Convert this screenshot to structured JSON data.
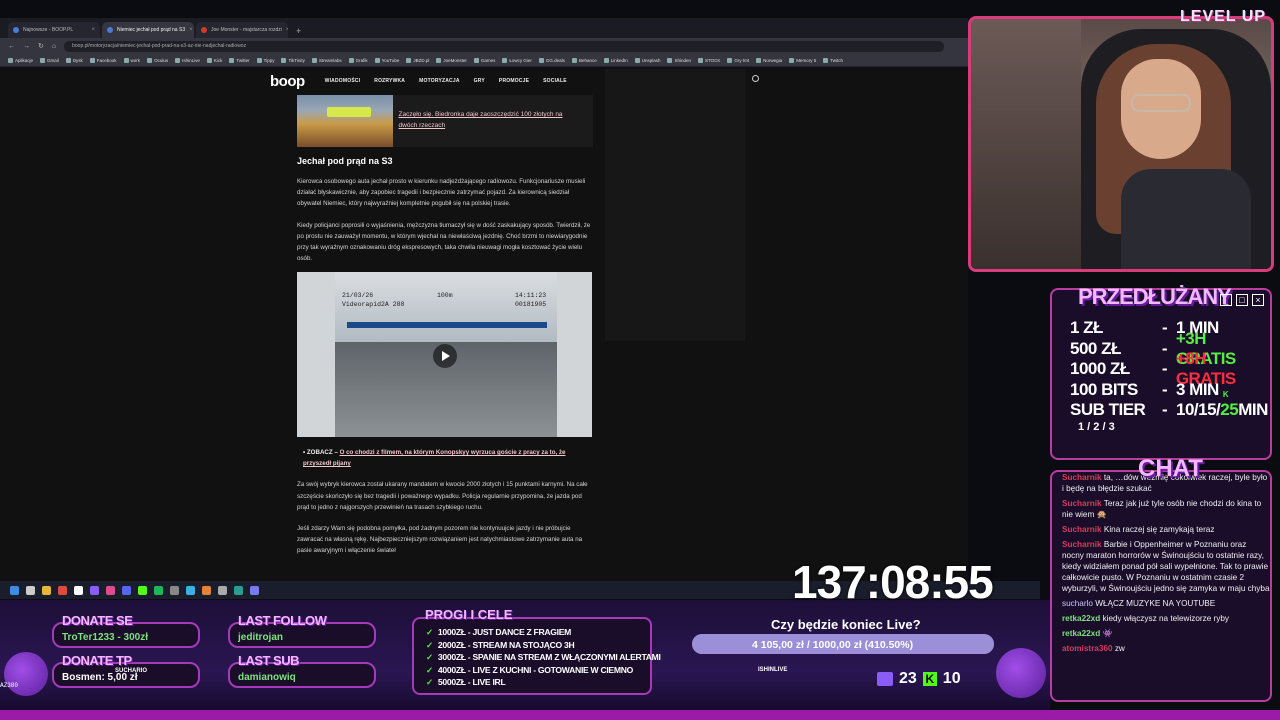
{
  "browser": {
    "tabs": [
      {
        "label": "Najnowsze - BOOP.PL",
        "color": "#4a7bd6"
      },
      {
        "label": "Niemiec jechał pod prąd na S3",
        "color": "#4a7bd6"
      },
      {
        "label": "Joe Monster - majstarcza rozdzi",
        "color": "#d23a2a"
      }
    ],
    "url": "boop.pl/motoryzacja/niemiec-jechal-pod-prad-na-s3-az-nie-nadjechal-radiowoz",
    "bookmarks": [
      "Aplikacje",
      "Gmail",
      "Dysk",
      "Facebook",
      "work",
      "Oculus",
      "IshinLive",
      "Kick",
      "Twitter",
      "Tippy",
      "TikTinity",
      "Streamlabs",
      "Grafik",
      "YouTube",
      "JBZD.pl",
      "JoeMonster",
      "Games",
      "Łowcy Gier",
      "GG.deals",
      "Behance",
      "LinkedIn",
      "Unsplash",
      "Shinden",
      "STOCK",
      "Gry tmt",
      "Norwegia",
      "Memory 5",
      "Twitch"
    ]
  },
  "site": {
    "logo": "boop",
    "nav": [
      "WIADOMOŚCI",
      "ROZRYWKA",
      "MOTORYZACJA",
      "GRY",
      "PROMOCJE",
      "SOCIALE"
    ]
  },
  "article": {
    "related_title": "Zaczęło się. Biedronka daje zaoszczędzić 100 złotych na dwóch rzeczach",
    "heading": "Jechał pod prąd na S3",
    "p1": "Kierowca osobowego auta jechał prosto w kierunku nadjeżdżającego radiowozu. Funkcjonariusze musieli działać błyskawicznie, aby zapobiec tragedii i bezpiecznie zatrzymać pojazd. Za kierownicą siedział obywatel Niemiec, który najwyraźniej kompletnie pogubił się na polskiej trasie.",
    "p2": "Kiedy policjanci poprosili o wyjaśnienia, mężczyzna tłumaczył się w dość zaskakujący sposób. Twierdził, że po prostu nie zauważył momentu, w którym wjechał na niewłaściwą jezdnię. Choć brzmi to niewiarygodnie przy tak wyraźnym oznakowaniu dróg ekspresowych, taka chwila nieuwagi mogła kosztować życie wielu osób.",
    "video_date": "21/03/26",
    "video_cam": "Videorapid2A 288",
    "video_speed": "100m",
    "video_time": "14:11:23",
    "video_id": "00181905",
    "bullet_prefix": "ZOBACZ –",
    "bullet_link": "O co chodzi z filmem, na którym Konopskyy wyrzuca goście z pracy za to, że przyszedł pijany",
    "p3": "Za swój wybryk kierowca został ukarany mandatem w kwocie 2000 złotych i 15 punktami karnymi. Na całe szczęście skończyło się bez tragedii i poważnego wypadku. Policja regularnie przypomina, że jazda pod prąd to jedno z najgorszych przewinień na trasach szybkiego ruchu.",
    "p4": "Jeśli zdarzy Wam się podobna pomyłka, pod żadnym pozorem nie kontynuujcie jazdy i nie próbujcie zawracać na własną rękę. Najbezpieczniejszym rozwiązaniem jest natychmiastowe zatrzymanie auta na pasie awaryjnym i włączenie świateł"
  },
  "overlay": {
    "brand": "LEVEL UP",
    "extension": {
      "title": "PRZEDŁUŻANY",
      "rows": [
        {
          "amount": "1 ZŁ",
          "value": "1 MIN",
          "style": "white"
        },
        {
          "amount": "500 ZŁ",
          "value": "+3H GRATIS",
          "style": "green"
        },
        {
          "amount": "1000 ZŁ",
          "value": "+8H GRATIS",
          "style": "red"
        },
        {
          "amount": "100 BITS",
          "value": "3 MIN",
          "style": "white"
        }
      ],
      "subtier_label": "SUB TIER",
      "subtier_levels": "1 / 2 / 3",
      "subtier_value_a": "10/15/",
      "subtier_value_b": "25",
      "subtier_value_c": " MIN",
      "subtier_k": "K"
    },
    "chat": {
      "title": "CHAT",
      "messages": [
        {
          "user": "Sucharnik",
          "text": "ta, …dów weźmię cokolwiek raczej, byle było i będę na błędzie szukać",
          "cls": "u"
        },
        {
          "user": "Sucharnik",
          "text": "Teraz jak już tyle osób nie chodzi do kina to nie wiem 🙊",
          "cls": "u"
        },
        {
          "user": "Sucharnik",
          "text": "Kina raczej się zamykają teraz",
          "cls": "u"
        },
        {
          "user": "Sucharnik",
          "text": "Barbie i Oppenheimer w Poznaniu oraz nocny maraton horrorów w Świnoujściu to ostatnie razy, kiedy widziałem ponad pół sali wypełnione. Tak to prawie całkowicie pusto. W Poznaniu w ostatnim czasie 2 wyburzyli, w Świnoujściu jedno się zamyka w maju chyba",
          "cls": "u"
        },
        {
          "user": "sucharlo",
          "text": "WŁĄCZ MUZYKE NA YOUTUBE",
          "cls": "u3"
        },
        {
          "user": "retka22xd",
          "text": "kiedy włączysz na telewizorze ryby",
          "cls": "u2"
        },
        {
          "user": "retka22xd",
          "text": "👾",
          "cls": "u2"
        },
        {
          "user": "atomistra360",
          "text": "zw",
          "cls": "u"
        }
      ]
    },
    "donate_se": {
      "label": "DONATE SE",
      "value": "TroTer1233 - 300zł"
    },
    "donate_tp": {
      "label": "DONATE TP",
      "value": "Bosmen: 5,00 zł",
      "tag": "SUCHARIO"
    },
    "last_follow": {
      "label": "LAST FOLLOW",
      "value": "jeditrojan"
    },
    "last_sub": {
      "label": "LAST SUB",
      "value": "damianowiq"
    },
    "goals": {
      "title": "PROGI I CELE",
      "items": [
        "1000ZŁ - JUST DANCE Z FRAGIEM",
        "2000ZŁ - STREAM NA STOJĄCO 3H",
        "3000ZŁ - SPANIE NA STREAM Z WŁĄCZONYMI ALERTAMI",
        "4000ZŁ - LIVE Z KUCHNI - GOTOWANIE W CIEMNO",
        "5000ZŁ - LIVE IRL"
      ]
    },
    "timer": "137:08:55",
    "poll": {
      "question": "Czy będzie koniec Live?",
      "value_text": "4 105,00 zł  /  1000,00 zł (410.50%)",
      "progress_fraction": 1.0
    },
    "streamer_tag": "ISHINLIVE",
    "viewers_twitch": "23",
    "viewers_kick": "10",
    "corner_label": "AZ380"
  }
}
